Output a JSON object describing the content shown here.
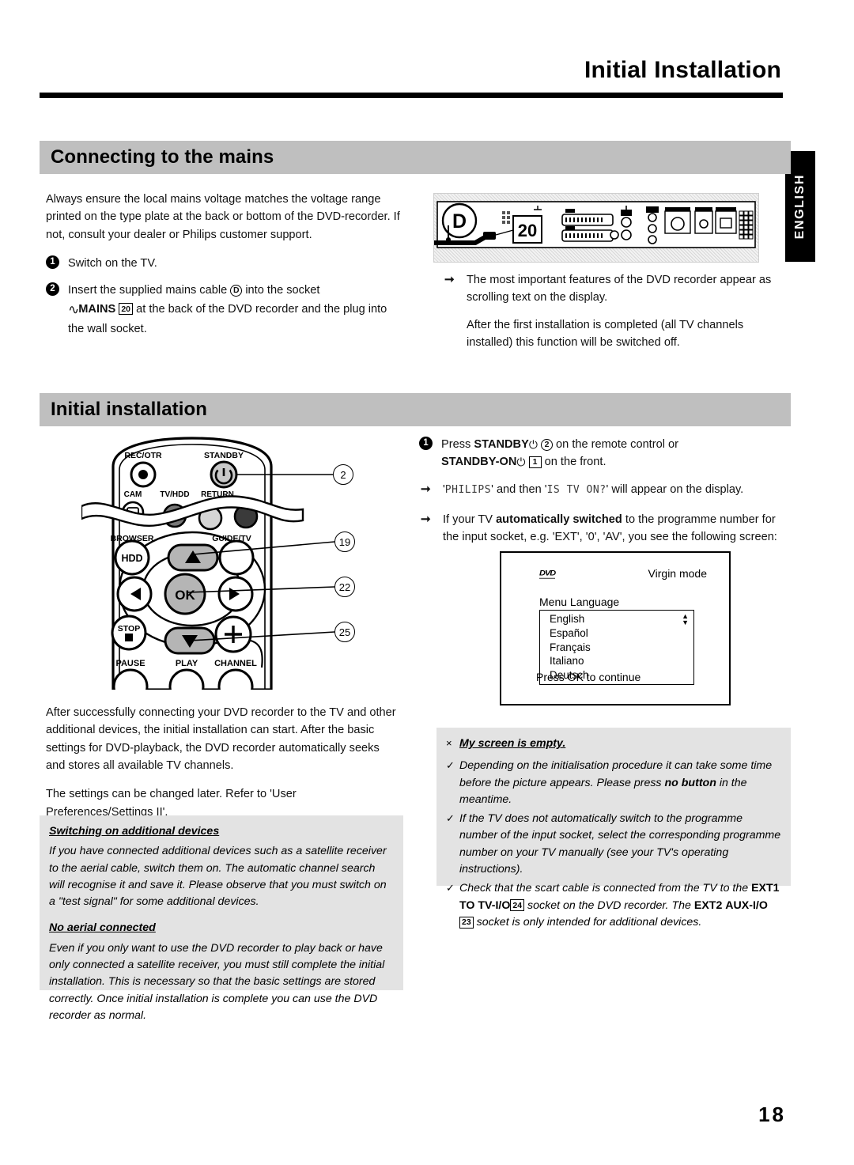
{
  "header": {
    "title": "Initial Installation",
    "language_tab": "ENGLISH"
  },
  "page_number": "18",
  "sections": {
    "mains": {
      "heading": "Connecting to the mains",
      "intro": "Always ensure the local mains voltage matches the voltage range printed on the type plate at the back or bottom of the DVD-recorder. If not, consult your dealer or Philips customer support.",
      "steps": [
        {
          "num": "1",
          "text": "Switch on the TV."
        },
        {
          "num": "2",
          "line1_a": "Insert the supplied mains cable",
          "cable_ref": "D",
          "line1_b": "into the socket",
          "mains_label": "MAINS",
          "mains_ref": "20",
          "line2": "at the back of the DVD recorder and the plug into the wall socket."
        }
      ],
      "right_notes": [
        "The most important features of the DVD recorder appear as scrolling text on the display.",
        "After the first installation is completed (all TV channels installed) this function will be switched off."
      ],
      "rear_panel": {
        "cable_label": "D",
        "socket_number": "20"
      }
    },
    "install": {
      "heading": "Initial installation",
      "remote": {
        "buttons": [
          "REC/OTR",
          "STANDBY",
          "CAM",
          "TV/HDD",
          "RETURN",
          "BROWSER",
          "GUIDE/TV",
          "HDD",
          "OK",
          "STOP",
          "PAUSE",
          "PLAY",
          "CHANNEL"
        ],
        "callouts": [
          "2",
          "19",
          "22",
          "25"
        ]
      },
      "step1": {
        "num": "1",
        "press_word": "Press",
        "standby_label": "STANDBY",
        "standby_ref": "2",
        "remote_text": "on the remote control or",
        "standby_on_label": "STANDBY-ON",
        "standby_on_ref": "1",
        "front_text": "on the front."
      },
      "arrow_display": {
        "quote1": "PHILIPS",
        "mid": "and then",
        "quote2": "IS TV ON?",
        "tail": "will appear on the display."
      },
      "arrow_switched": {
        "pre": "If your TV",
        "bold": "automatically switched",
        "post": "to the programme number for the input socket, e.g. 'EXT', '0', 'AV', you see the following screen:"
      },
      "tv_screen": {
        "logo": "DVD",
        "mode": "Virgin mode",
        "menu_label": "Menu Language",
        "options": [
          "English",
          "Español",
          "Français",
          "Italiano",
          "Deutsch"
        ],
        "footer": "Press OK to continue"
      },
      "left_paragraphs": [
        "After successfully connecting your DVD recorder to the TV and other additional devices, the initial installation can start. After the basic settings for DVD-playback, the DVD recorder automatically seeks and stores all available TV channels.",
        "The settings can be changed later. Refer to 'User Preferences/Settings II'."
      ],
      "tip_left": {
        "head1": "Switching on additional devices",
        "body1": "If you have connected additional devices such as a satellite receiver to the aerial cable, switch them on. The automatic channel search will recognise it and save it. Please observe that you must switch on a \"test signal\" for some additional devices.",
        "head2": "No aerial connected",
        "body2": "Even if you only want to use the DVD recorder to play back or have only connected a satellite receiver, you must still complete the initial installation. This is necessary so that the basic settings are stored correctly. Once initial installation is complete you can use the DVD recorder as normal."
      },
      "tip_right": {
        "marker_x": "×",
        "marker_check": "✓",
        "head": "My screen is empty.",
        "item1_a": "Depending on the initialisation procedure it can take some time before the picture appears. Please press",
        "item1_bold": "no button",
        "item1_b": "in the meantime.",
        "item2": "If the TV does not automatically switch to the programme number of the input socket, select the corresponding programme number on your TV manually (see your TV's operating instructions).",
        "item3_a": "Check that the scart cable is connected from the TV to the",
        "item3_ext1": "EXT1",
        "item3_totv": "TO TV-I/O",
        "item3_ref24": "24",
        "item3_b": "socket on the DVD recorder. The",
        "item3_ext2": "EXT2",
        "item3_aux": "AUX-I/O",
        "item3_ref23": "23",
        "item3_c": "socket is only intended for additional devices."
      }
    }
  }
}
